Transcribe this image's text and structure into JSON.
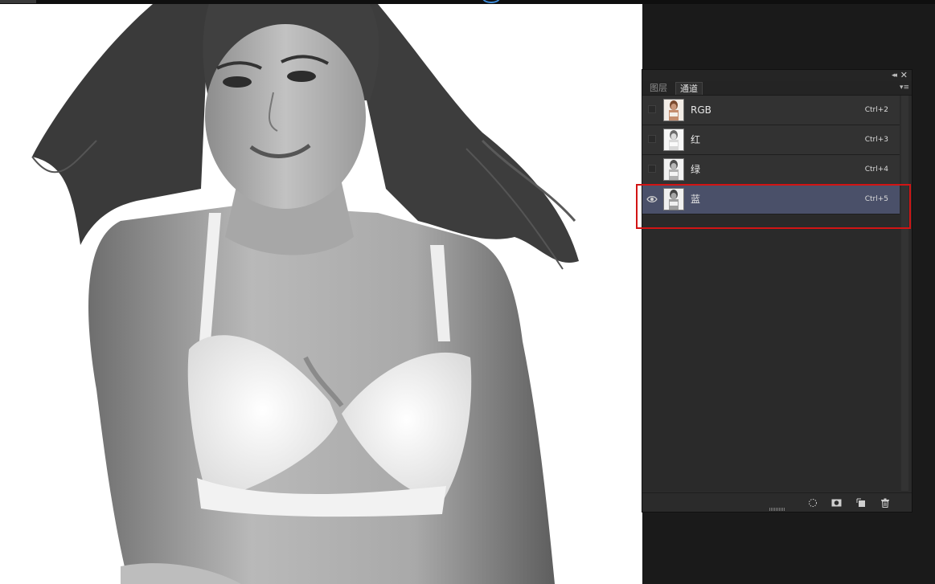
{
  "panel": {
    "tabs": [
      {
        "label": "图层"
      },
      {
        "label": "通道"
      }
    ],
    "active_tab": "通道",
    "collapse_glyph": "◂◂",
    "close_glyph": "✕",
    "menu_glyph": "▾≡",
    "channels": [
      {
        "name": "RGB",
        "shortcut": "Ctrl+2",
        "visible": false,
        "selected": false,
        "thumbnail": "color"
      },
      {
        "name": "红",
        "shortcut": "Ctrl+3",
        "visible": false,
        "selected": false,
        "thumbnail": "grayscale"
      },
      {
        "name": "绿",
        "shortcut": "Ctrl+4",
        "visible": false,
        "selected": false,
        "thumbnail": "grayscale"
      },
      {
        "name": "蓝",
        "shortcut": "Ctrl+5",
        "visible": true,
        "selected": true,
        "thumbnail": "grayscale"
      }
    ],
    "footer_icons": [
      "load-channel-as-selection-icon",
      "save-selection-as-channel-icon",
      "new-channel-icon",
      "delete-channel-icon"
    ]
  },
  "colors": {
    "selection_highlight": "#4a5069",
    "annotation_box": "#d21414",
    "panel_bg": "#2b2b2b"
  }
}
